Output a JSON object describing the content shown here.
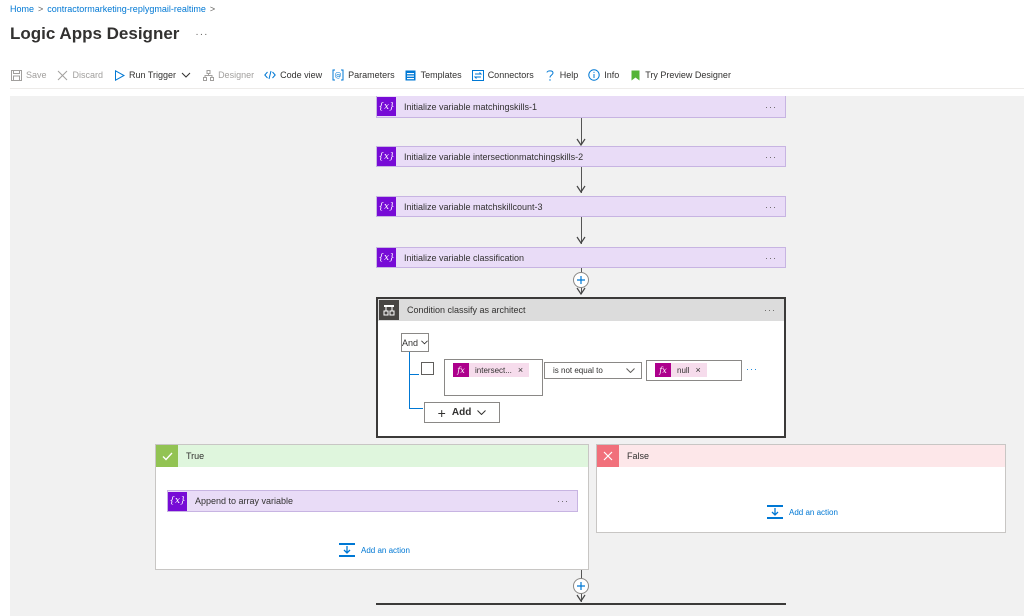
{
  "breadcrumb": {
    "home": "Home",
    "sep": ">",
    "resource": "contractormarketing-replygmail-realtime",
    "trail_sep": ">"
  },
  "page": {
    "title": "Logic Apps Designer",
    "more": "···"
  },
  "toolbar": {
    "save": "Save",
    "discard": "Discard",
    "run_trigger": "Run Trigger",
    "designer": "Designer",
    "code_view": "Code view",
    "parameters": "Parameters",
    "templates": "Templates",
    "connectors": "Connectors",
    "help": "Help",
    "info": "Info",
    "try_preview": "Try Preview Designer"
  },
  "steps": [
    {
      "label": "Initialize variable matchingskills-1",
      "icon": "variable-icon"
    },
    {
      "label": "Initialize variable intersectionmatchingskills-2",
      "icon": "variable-icon"
    },
    {
      "label": "Initialize variable matchskillcount-3",
      "icon": "variable-icon"
    },
    {
      "label": "Initialize variable classification",
      "icon": "variable-icon"
    }
  ],
  "card_icon_text": "{x}",
  "card_more": "···",
  "condition": {
    "title": "Condition classify as architect",
    "group_operator": "And",
    "left_token": "intersect...",
    "operator": "is not equal to",
    "right_token": "null",
    "token_icon": "fx",
    "token_remove": "×",
    "add_label": "Add",
    "row_more": "···"
  },
  "branches": {
    "true": {
      "label": "True",
      "action": "Append to array variable",
      "add_action": "Add an action"
    },
    "false": {
      "label": "False",
      "add_action": "Add an action"
    }
  },
  "colors": {
    "accent": "#0078d4",
    "variable_purple": "#770bd6",
    "card_bg": "#e9dcf7",
    "expression_magenta": "#ad008c",
    "true_green": "#92c353",
    "false_red": "#f1707b"
  }
}
